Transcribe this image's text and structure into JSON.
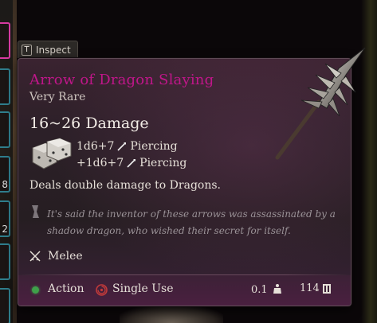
{
  "inspect_tab": {
    "key": "T",
    "label": "Inspect"
  },
  "item": {
    "name": "Arrow of Dragon Slaying",
    "rarity": "Very Rare",
    "damage": "16~26 Damage",
    "damage_lines": [
      {
        "dice": "1d6+7",
        "type": "Piercing"
      },
      {
        "dice": "+1d6+7",
        "type": "Piercing"
      }
    ],
    "description": "Deals double damage to Dragons.",
    "lore": "It's said the inventor of these arrows was assassinated by a shadow dragon, who wished their secret for itself.",
    "attack_type": "Melee"
  },
  "footer": {
    "action": "Action",
    "usage": "Single Use",
    "weight": "0.1",
    "value": "114"
  },
  "hotbar_counts": [
    "8",
    "2"
  ],
  "colors": {
    "title": "#c0168a",
    "action_dot": "#3fa04a",
    "slot_border": "#2f7e8c",
    "slot_active": "#d63aa0"
  },
  "icons": {
    "dice": "dice-icon",
    "piercing": "piercing-icon",
    "lore": "scroll-icon",
    "melee": "crossed-swords-icon",
    "single_use": "single-use-icon",
    "weight": "weight-icon",
    "value": "coin-icon",
    "item_art": "arrow-icon"
  }
}
